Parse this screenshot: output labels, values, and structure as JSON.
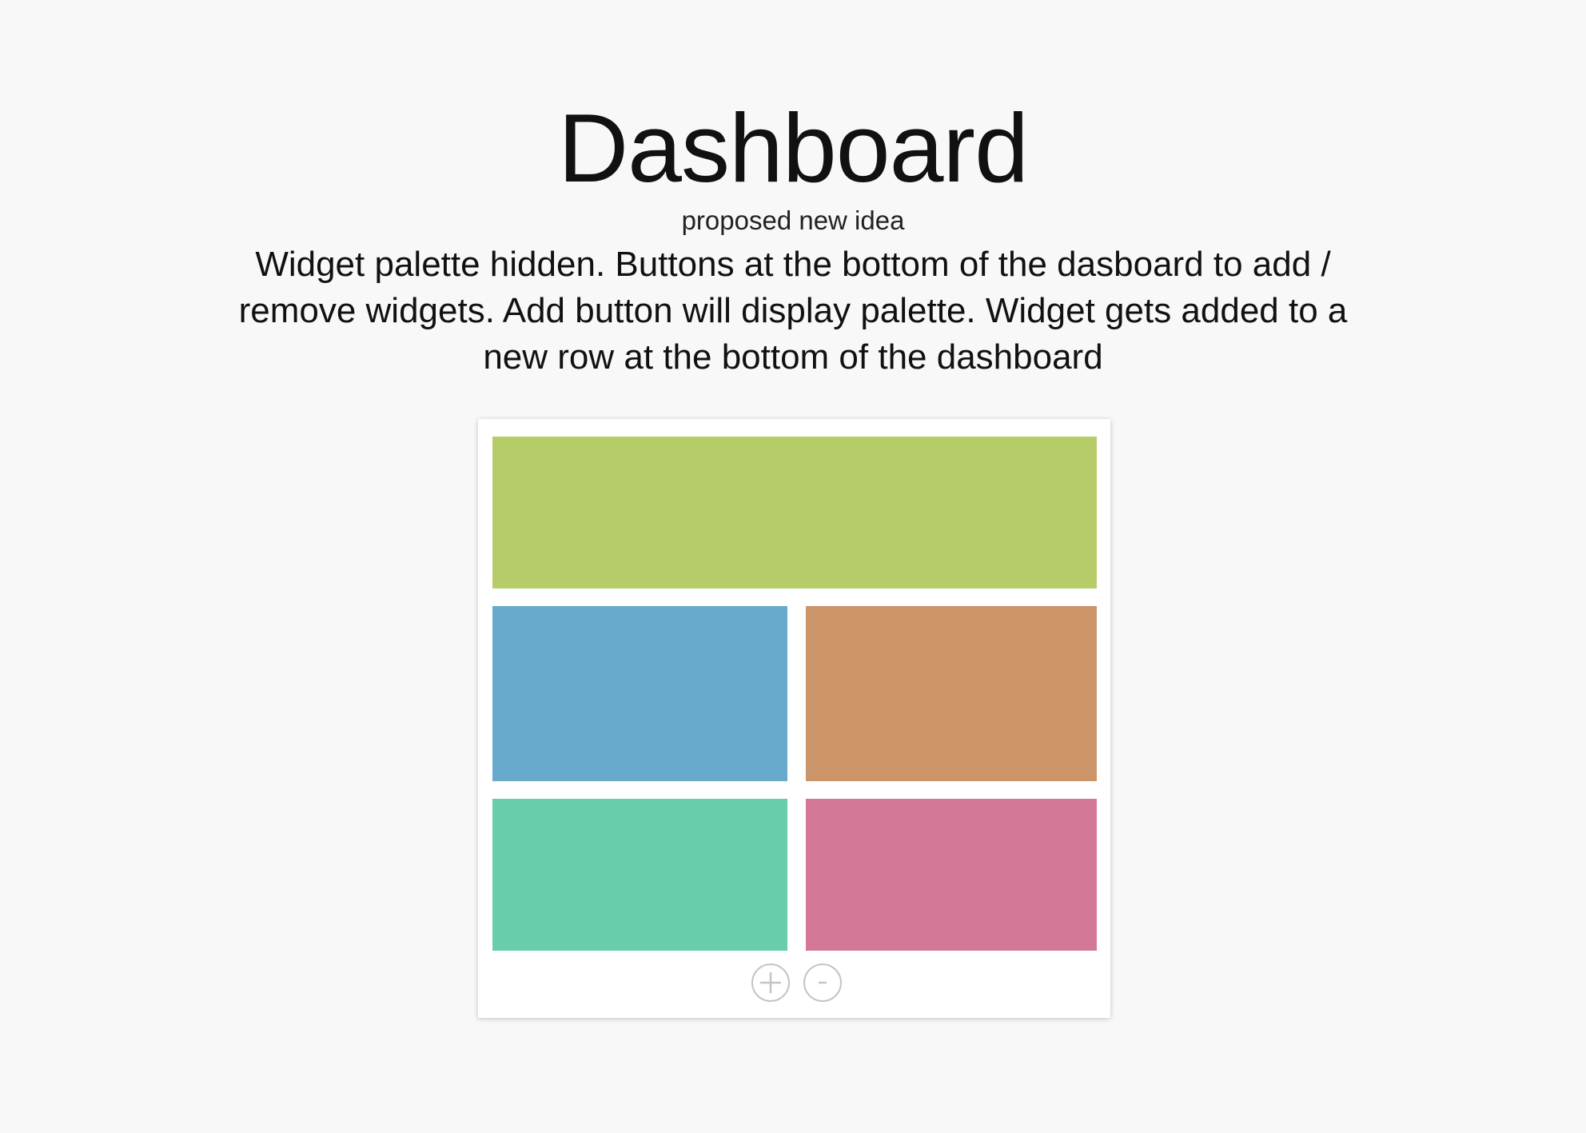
{
  "header": {
    "title": "Dashboard",
    "subtitle": "proposed new idea"
  },
  "description": "Widget palette hidden. Buttons at the bottom of the dasboard to add / remove widgets. Add button will display palette. Widget gets added to a new row at the bottom of the dashboard",
  "dashboard": {
    "widgets": [
      {
        "name": "widget-top",
        "color": "#b5cc69"
      },
      {
        "name": "widget-mid-left",
        "color": "#67aacb"
      },
      {
        "name": "widget-mid-right",
        "color": "#cc9469"
      },
      {
        "name": "widget-bottom-left",
        "color": "#67cdaa"
      },
      {
        "name": "widget-bottom-right",
        "color": "#d27896"
      }
    ],
    "controls": {
      "add_icon": "plus-icon",
      "remove_icon": "minus-icon",
      "icon_color": "#c4c4c4"
    }
  }
}
